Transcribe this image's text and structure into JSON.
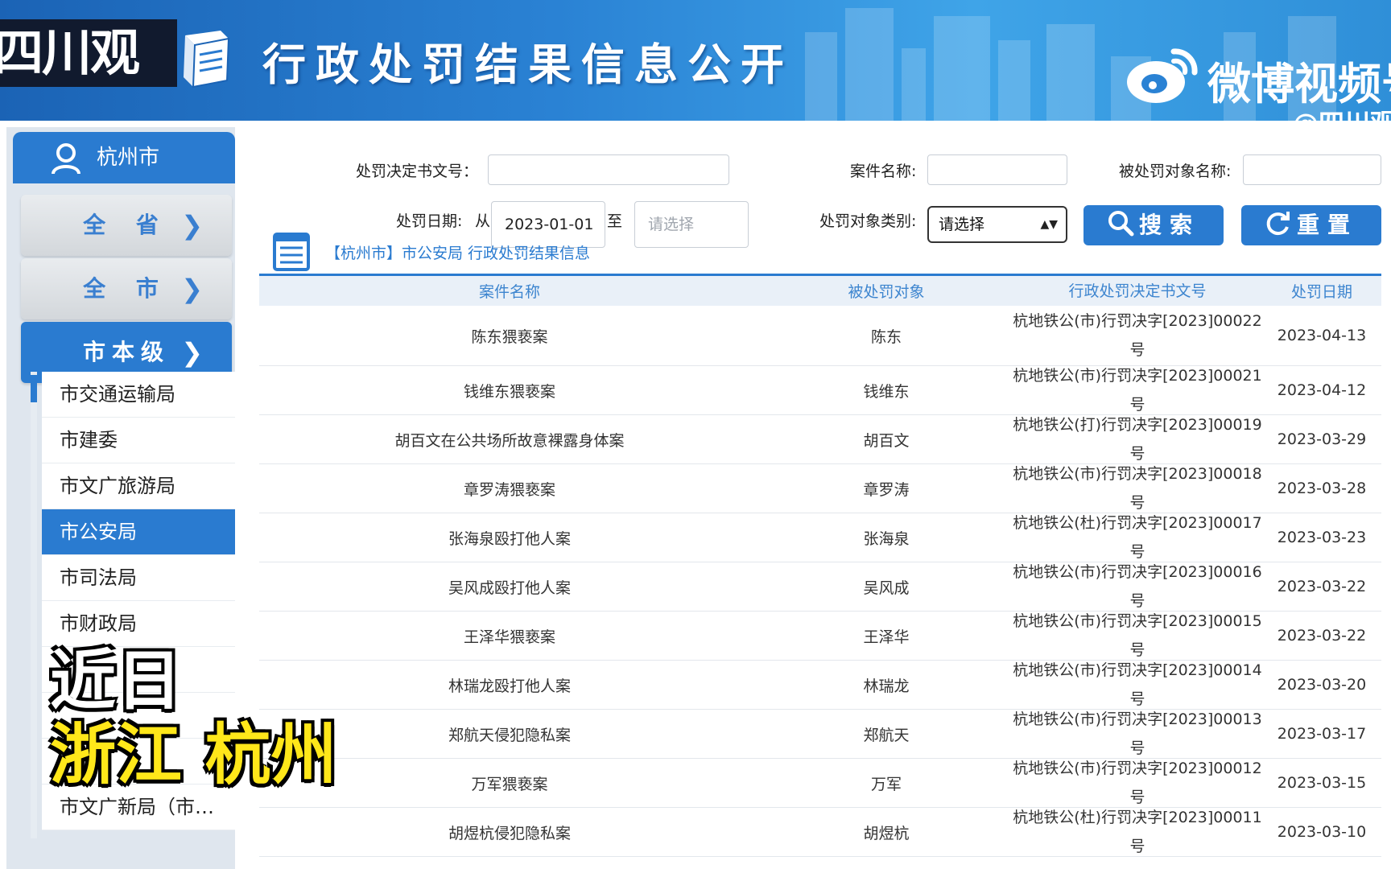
{
  "banner": {
    "title": "行政处罚结果信息公开",
    "logo_text": "四川观察",
    "watermark": "微博视频号",
    "watermark_handle": "@四川观察"
  },
  "sidebar": {
    "city": "杭州市",
    "buttons": [
      "全 省",
      "全 市",
      "市本级"
    ],
    "items": [
      "市交通运输局",
      "市建委",
      "市文广旅游局",
      "市公安局",
      "市司法局",
      "市财政局",
      "",
      "",
      "",
      "市文广新局（市…"
    ],
    "active_item": "市公安局"
  },
  "caption": {
    "line1": "近日",
    "line2": "浙江 杭州"
  },
  "search": {
    "doc_no_label": "处罚决定书文号：",
    "case_name_label": "案件名称:",
    "target_name_label": "被处罚对象名称:",
    "date_label": "处罚日期:",
    "from_label": "从",
    "date_from": "2023-01-01",
    "to_label": "至",
    "date_to_placeholder": "请选择",
    "category_label": "处罚对象类别:",
    "category_value": "请选择",
    "search_button": "搜索",
    "reset_button": "重置"
  },
  "info": {
    "text": "【杭州市】市公安局 行政处罚结果信息"
  },
  "table": {
    "headers": [
      "案件名称",
      "被处罚对象",
      "行政处罚决定书文号",
      "处罚日期"
    ],
    "rows": [
      [
        "陈东猥亵案",
        "陈东",
        "杭地铁公(市)行罚决字[2023]00022号",
        "2023-04-13"
      ],
      [
        "钱维东猥亵案",
        "钱维东",
        "杭地铁公(市)行罚决字[2023]00021号",
        "2023-04-12"
      ],
      [
        "胡百文在公共场所故意裸露身体案",
        "胡百文",
        "杭地铁公(打)行罚决字[2023]00019号",
        "2023-03-29"
      ],
      [
        "章罗涛猥亵案",
        "章罗涛",
        "杭地铁公(市)行罚决字[2023]00018号",
        "2023-03-28"
      ],
      [
        "张海泉殴打他人案",
        "张海泉",
        "杭地铁公(杜)行罚决字[2023]00017号",
        "2023-03-23"
      ],
      [
        "吴风成殴打他人案",
        "吴风成",
        "杭地铁公(市)行罚决字[2023]00016号",
        "2023-03-22"
      ],
      [
        "王泽华猥亵案",
        "王泽华",
        "杭地铁公(市)行罚决字[2023]00015号",
        "2023-03-22"
      ],
      [
        "林瑞龙殴打他人案",
        "林瑞龙",
        "杭地铁公(市)行罚决字[2023]00014号",
        "2023-03-20"
      ],
      [
        "郑航天侵犯隐私案",
        "郑航天",
        "杭地铁公(市)行罚决字[2023]00013号",
        "2023-03-17"
      ],
      [
        "万军猥亵案",
        "万军",
        "杭地铁公(市)行罚决字[2023]00012号",
        "2023-03-15"
      ],
      [
        "胡煜杭侵犯隐私案",
        "胡煜杭",
        "杭地铁公(杜)行罚决字[2023]00011号",
        "2023-03-10"
      ]
    ]
  },
  "colors": {
    "primary": "#2a7bd0",
    "caption_yellow": "#ffe71a"
  }
}
